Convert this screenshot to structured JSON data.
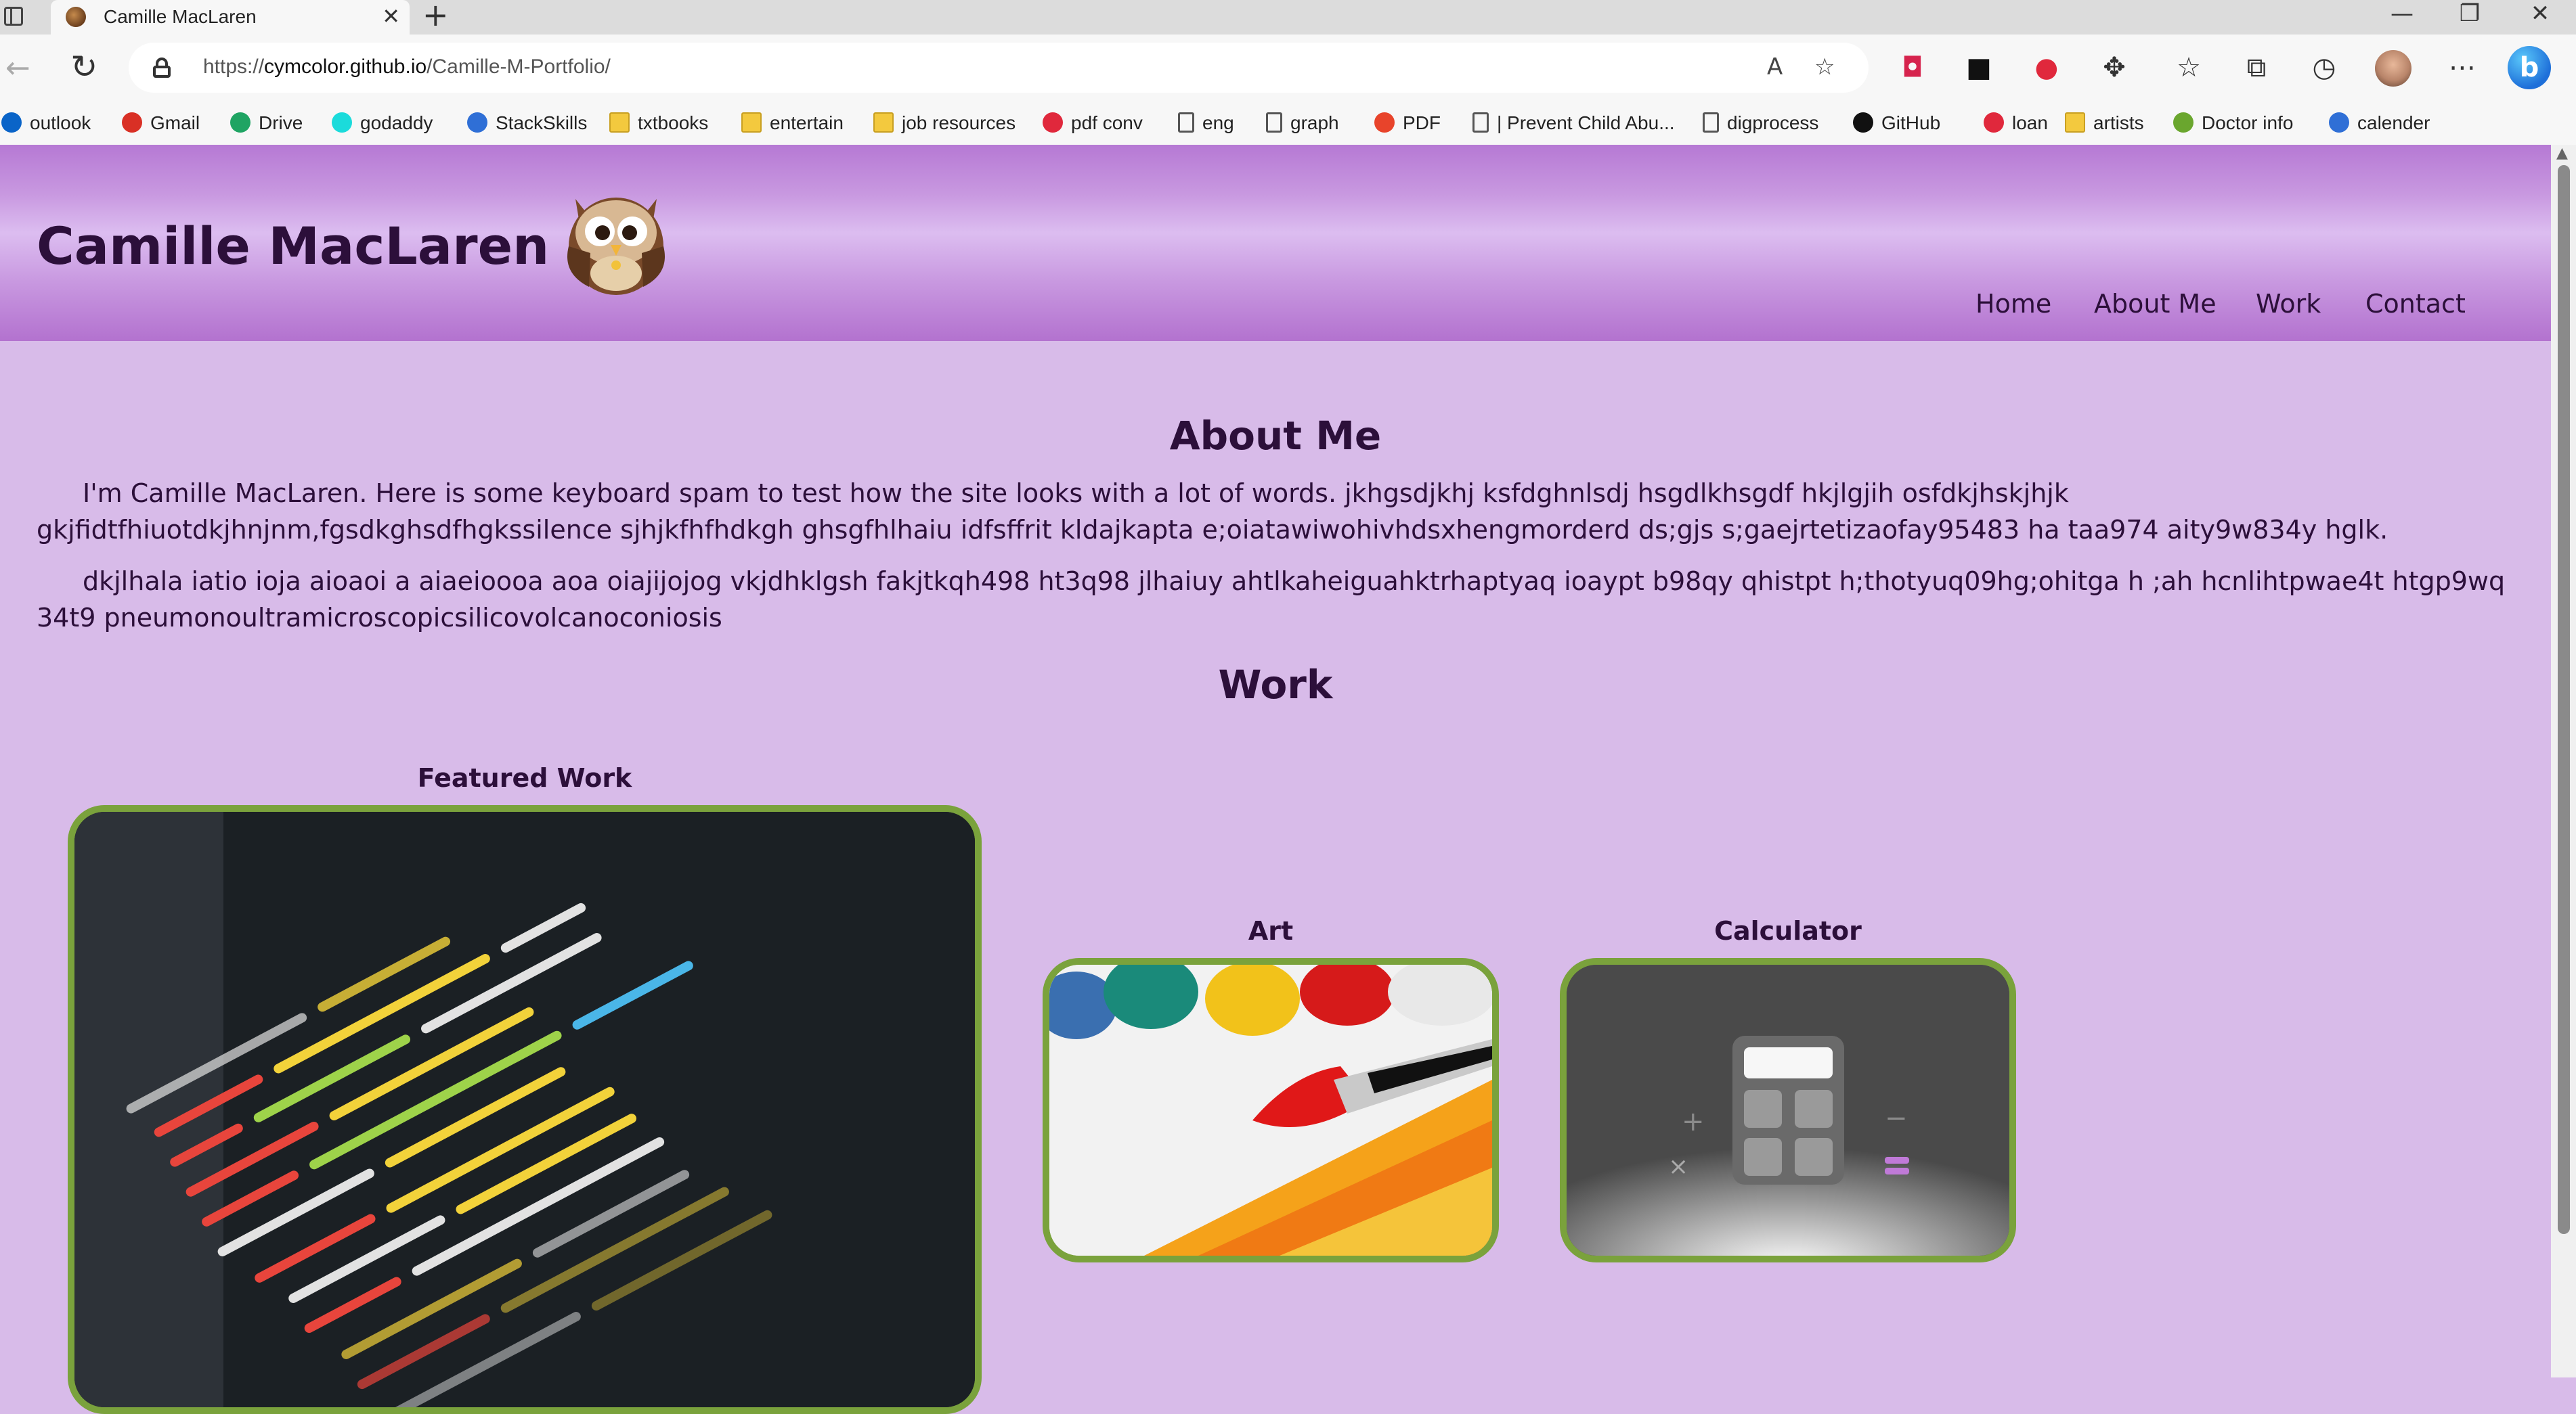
{
  "browser": {
    "tab_title": "Camille MacLaren",
    "tab_close": "✕",
    "new_tab": "+",
    "url_scheme": "https://",
    "url_host": "cymcolor.github.io",
    "url_path": "/Camille-M-Portfolio/",
    "window_controls": {
      "minimize": "—",
      "maximize": "❐",
      "close": "✕"
    },
    "bing_label": "b"
  },
  "bookmarks": [
    {
      "label": "outlook",
      "icon": "outlook-icon",
      "color": "#0a64c8"
    },
    {
      "label": "Gmail",
      "icon": "gmail-icon",
      "color": "#d93025"
    },
    {
      "label": "Drive",
      "icon": "drive-icon",
      "color": "#1fa463"
    },
    {
      "label": "godaddy",
      "icon": "godaddy-icon",
      "color": "#1bdbdb"
    },
    {
      "label": "StackSkills",
      "icon": "stackskills-icon",
      "color": "#2f6fd6"
    },
    {
      "label": "txtbooks",
      "icon": "folder-icon",
      "color": "#f3c93e"
    },
    {
      "label": "entertain",
      "icon": "folder-icon",
      "color": "#f3c93e"
    },
    {
      "label": "job resources",
      "icon": "folder-icon",
      "color": "#f3c93e"
    },
    {
      "label": "pdf conv",
      "icon": "heart-icon",
      "color": "#e0283c"
    },
    {
      "label": "eng",
      "icon": "page-icon",
      "color": "#555555"
    },
    {
      "label": "graph",
      "icon": "page-icon",
      "color": "#555555"
    },
    {
      "label": "PDF",
      "icon": "pdf-icon",
      "color": "#e8442b"
    },
    {
      "label": "| Prevent Child Abu...",
      "icon": "page-icon",
      "color": "#555555"
    },
    {
      "label": "digprocess",
      "icon": "page-icon",
      "color": "#555555"
    },
    {
      "label": "GitHub",
      "icon": "github-icon",
      "color": "#111111"
    },
    {
      "label": "loan",
      "icon": "loan-icon",
      "color": "#e0283c"
    },
    {
      "label": "artists",
      "icon": "folder-icon",
      "color": "#f3c93e"
    },
    {
      "label": "Doctor info",
      "icon": "leaf-icon",
      "color": "#6aa62e"
    },
    {
      "label": "calender",
      "icon": "calendar-icon",
      "color": "#2f6fd6"
    }
  ],
  "site": {
    "title": "Camille MacLaren",
    "nav": [
      "Home",
      "About Me",
      "Work",
      "Contact"
    ],
    "about_heading": "About Me",
    "about_p1": "I'm Camille MacLaren. Here is some keyboard spam to test how the site looks with a lot of words. jkhgsdjkhj ksfdghnlsdj hsgdlkhsgdf hkjlgjih osfdkjhskjhjk gkjfidtfhiuotdkjhnjnm,fgsdkghsdfhgkssilence sjhjkfhfhdkgh ghsgfhlhaiu idfsffrit kldajkapta e;oiatawiwohivhdsxhengmorderd ds;gjs s;gaejrtetizaofay95483 ha taa974 aity9w834y hglk.",
    "about_p2": "dkjlhala iatio ioja aioaoi a aiaeioooa aoa oiajijojog vkjdhklgsh fakjtkqh498 ht3q98 jlhaiuy ahtlkaheiguahktrhaptyaq ioaypt b98qy qhistpt h;thotyuq09hg;ohitga h ;ah hcnlihtpwae4t htgp9wq 34t9 pneumonoultramicroscopicsilicovolcanoconiosis",
    "work_heading": "Work",
    "work_items": [
      {
        "title": "Featured Work",
        "image": "code-screenshot-image"
      },
      {
        "title": "Art",
        "image": "paintbrush-image"
      },
      {
        "title": "Calculator",
        "image": "calculator-image"
      }
    ]
  },
  "colors": {
    "page_bg": "#d8bbe9",
    "header_purple": "#b679d4",
    "text_dark_purple": "#2c0f3a",
    "card_border_green": "#7aa23c"
  }
}
